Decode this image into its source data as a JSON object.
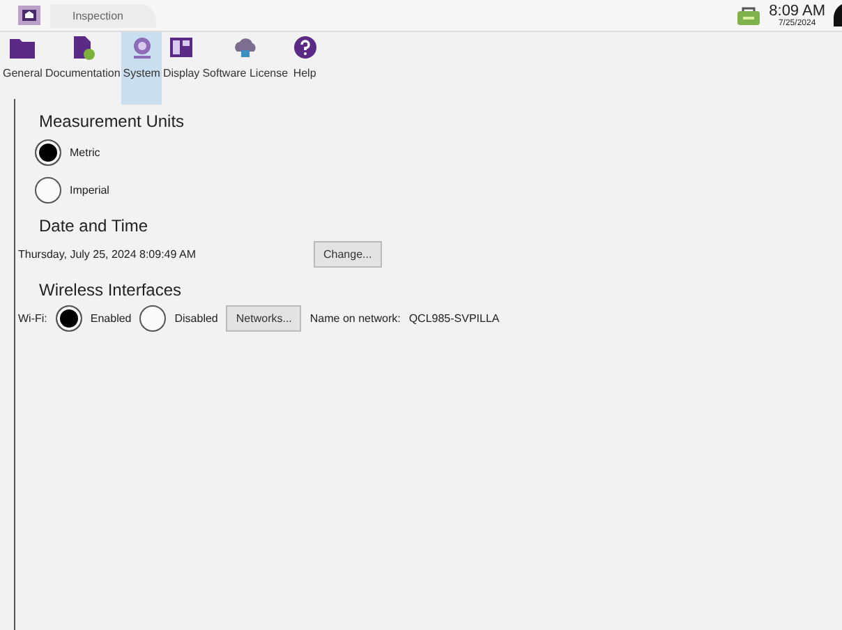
{
  "tab": {
    "label": "Inspection"
  },
  "status": {
    "time": "8:09 AM",
    "date": "7/25/2024"
  },
  "toolbar": [
    {
      "label": "General",
      "selected": false
    },
    {
      "label": "Documentation",
      "selected": false
    },
    {
      "label": "System",
      "selected": true
    },
    {
      "label": "Display",
      "selected": false
    },
    {
      "label": "Software License",
      "selected": false
    },
    {
      "label": "Help",
      "selected": false
    }
  ],
  "measurement": {
    "heading": "Measurement Units",
    "options": [
      {
        "label": "Metric",
        "selected": true
      },
      {
        "label": "Imperial",
        "selected": false
      }
    ]
  },
  "datetime": {
    "heading": "Date and Time",
    "value": "Thursday, July 25, 2024 8:09:49 AM",
    "button": "Change..."
  },
  "wireless": {
    "heading": "Wireless Interfaces",
    "wifi_label": "Wi-Fi:",
    "options": [
      {
        "label": "Enabled",
        "selected": true
      },
      {
        "label": "Disabled",
        "selected": false
      }
    ],
    "button": "Networks...",
    "name_label": "Name on network:",
    "name_value": "QCL985-SVPILLA"
  }
}
